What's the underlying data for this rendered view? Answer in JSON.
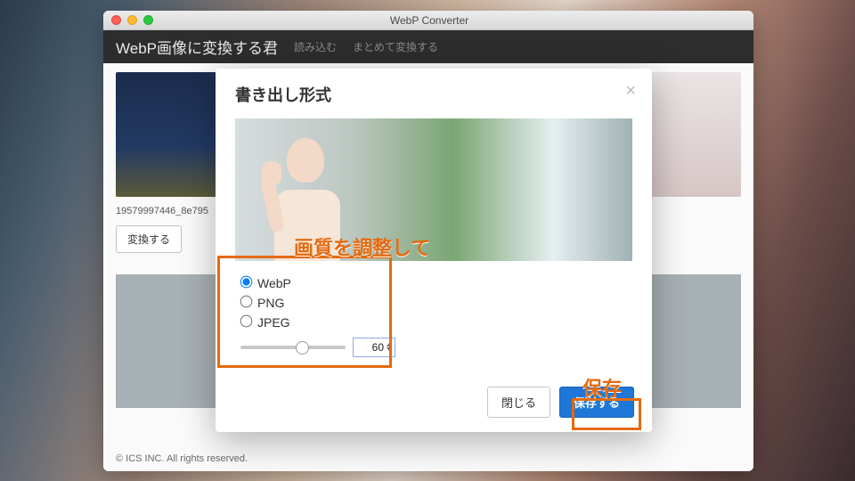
{
  "window": {
    "title": "WebP Converter"
  },
  "header": {
    "app_title": "WebP画像に変換する君",
    "nav_load": "読み込む",
    "nav_batch": "まとめて変換する"
  },
  "gallery": {
    "filename1": "19579997446_8e795",
    "convert_label": "変換する"
  },
  "footer": {
    "copyright": "© ICS INC. All rights reserved."
  },
  "modal": {
    "title": "書き出し形式",
    "formats": {
      "webp": "WebP",
      "png": "PNG",
      "jpeg": "JPEG"
    },
    "quality": 60,
    "close_label": "閉じる",
    "save_label": "保存する"
  },
  "annotations": {
    "quality_hint": "画質を調整して",
    "save_hint": "保存"
  }
}
